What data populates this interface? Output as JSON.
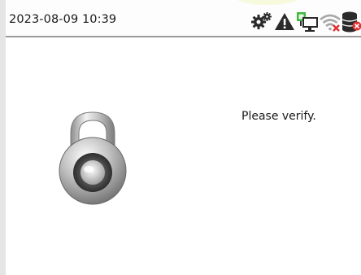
{
  "status_bar": {
    "datetime": "2023-08-09 10:39",
    "icons": [
      "gear-icon",
      "warning-icon",
      "network-icon",
      "wifi-disconnected-icon",
      "database-icon"
    ]
  },
  "main": {
    "prompt": "Please verify.",
    "lock_icon": "padlock-icon"
  },
  "colors": {
    "status_bar_bg": "#fdfdfd",
    "divider": "#9a9a9a",
    "network_icon": "#3fb83f",
    "error_red": "#e03030"
  }
}
